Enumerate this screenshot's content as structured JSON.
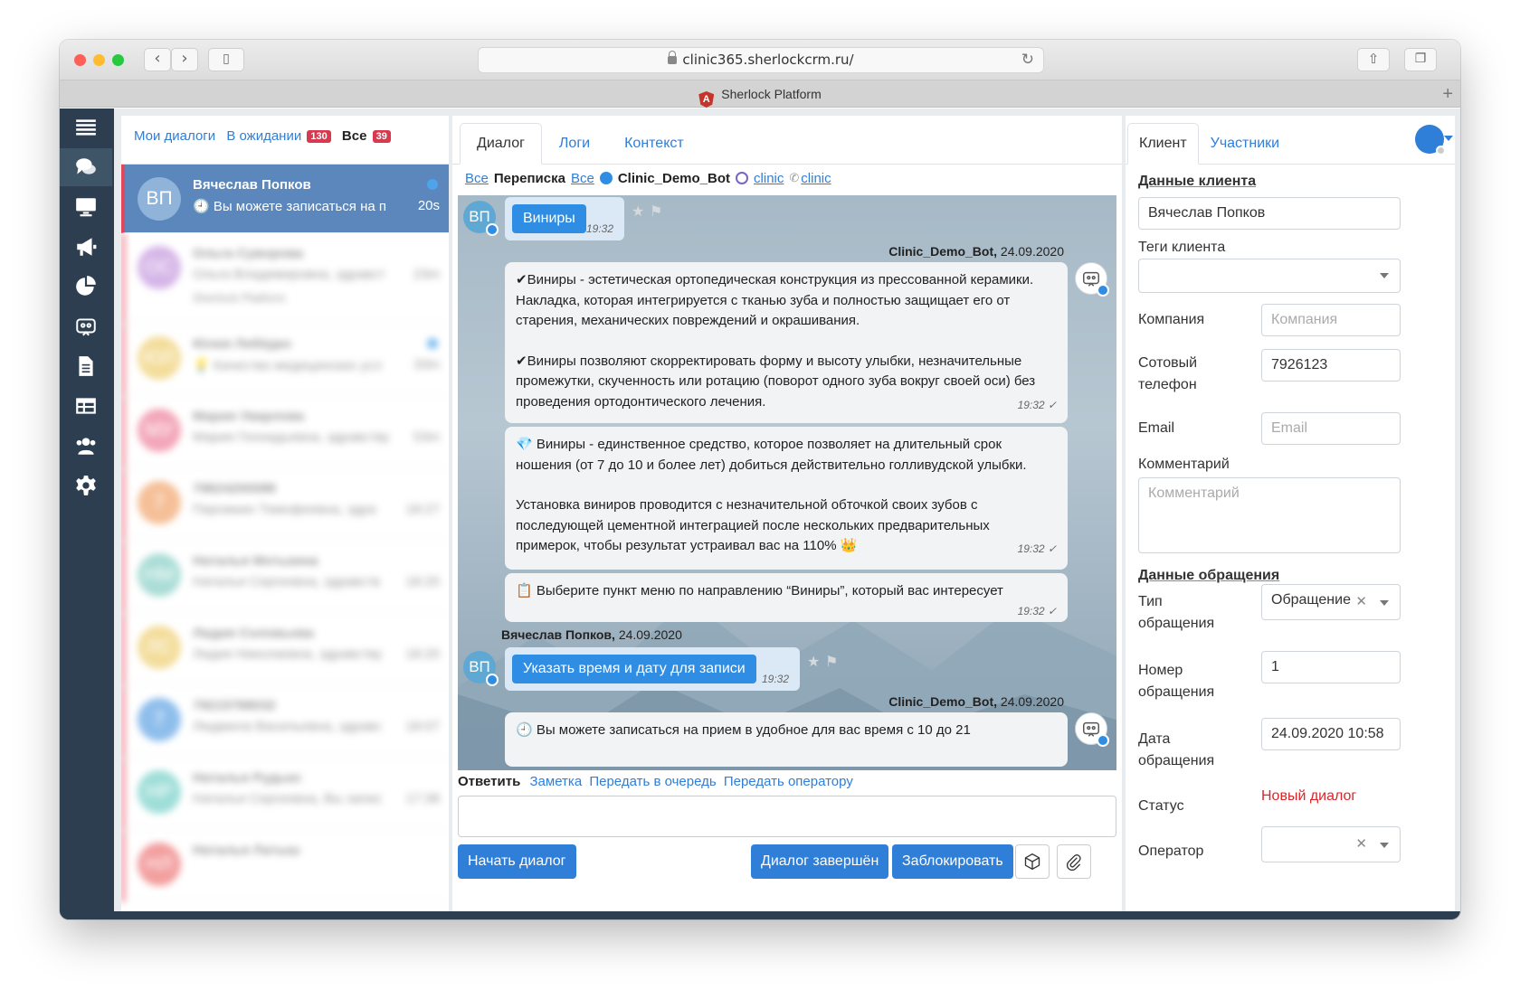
{
  "browser": {
    "url": "clinic365.sherlockcrm.ru/",
    "tab_title": "Sherlock Platform",
    "tab_logo_letter": "A"
  },
  "dialogs": {
    "tabs": [
      {
        "label": "Мои диалоги"
      },
      {
        "label": "В ожидании",
        "badge": "130"
      },
      {
        "label": "Все",
        "badge": "39"
      }
    ],
    "items": [
      {
        "initials": "ВП",
        "name": "Вячеслав Попков",
        "preview": "🕘 Вы можете записаться на п",
        "time": "20s",
        "color": "#8fb3d9"
      },
      {
        "initials": "ОС",
        "name": "Ольга Суворова",
        "preview": "Ольга Владимировна, здравст",
        "time": "23m",
        "extra": "Sherlock Platform",
        "color": "#c89ee0"
      },
      {
        "initials": "ЮЛ",
        "name": "Юлия Лебёдко",
        "preview": "💡 Качество медицинских усл",
        "time": "33m",
        "color": "#f0d27a"
      },
      {
        "initials": "МУ",
        "name": "Мария Уварлова",
        "preview": "Мария Геннадьевна, здравству",
        "time": "53m",
        "color": "#ef8aa2"
      },
      {
        "initials": "7",
        "name": "79824200088",
        "preview": "Пирожкин Тимофеевна, здра",
        "time": "18:27",
        "color": "#f2ab76"
      },
      {
        "initials": "НМ",
        "name": "Наталья Мотькина",
        "preview": "Наталья Сергеевна, здравств",
        "time": "18:20",
        "color": "#8fd2c8"
      },
      {
        "initials": "ЛС",
        "name": "Лидия Соловьева",
        "preview": "Лидия Николаевна, здравству",
        "time": "18:20",
        "color": "#f0d27a"
      },
      {
        "initials": "7",
        "name": "79215788032",
        "preview": "Людмила Васильевна, здравс",
        "time": "18:07",
        "color": "#6aa9e6"
      },
      {
        "initials": "НР",
        "name": "Наталья Рудько",
        "preview": "Наталья Сергеевна, Вы запис",
        "time": "17:38",
        "color": "#7fd3cc"
      },
      {
        "initials": "НЛ",
        "name": "Наталья Латыш",
        "preview": "",
        "time": "",
        "color": "#ef7f7f"
      }
    ]
  },
  "chat": {
    "tabs": [
      "Диалог",
      "Логи",
      "Контекст"
    ],
    "filter": {
      "all1": "Все",
      "label": "Переписка",
      "all2": "Все",
      "bot": "Clinic_Demo_Bot",
      "viber": "clinic",
      "phone": "clinic"
    },
    "messages": {
      "user_initials": "ВП",
      "m1_button": "Виниры",
      "m1_time": "19:32",
      "bot_sender": "Clinic_Demo_Bot,",
      "bot_date": "24.09.2020",
      "b1_p1": "✔Виниры - эстетическая ортопедическая конструкция из прессованной керамики. Накладка, которая интегрируется с тканью зуба и полностью защищает его от старения, механических повреждений и окрашивания.",
      "b1_p2": "✔Виниры позволяют скорректировать форму и высоту улыбки, незначительные промежутки, скученность или ротацию (поворот одного зуба вокруг своей оси) без проведения ортодонтического лечения.",
      "b1_time": "19:32 ✓",
      "b2_p1": "💎 Виниры - единственное средство, которое позволяет на длительный срок ношения (от 7 до 10 и более лет) добиться действительно голливудской улыбки.",
      "b2_p2": "Установка виниров проводится с незначительной обточкой своих зубов с последующей цементной интеграцией после нескольких предварительных примерок, чтобы результат устраивал вас на 110% 👑",
      "b2_time": "19:32 ✓",
      "b3": "📋 Выберите пункт меню по направлению “Виниры”, который вас интересует",
      "b3_time": "19:32 ✓",
      "user_sender": "Вячеслав Попков,",
      "user_date": "24.09.2020",
      "m2_button": "Указать время и дату для записи",
      "m2_time": "19:32",
      "bot_sender2": "Clinic_Demo_Bot,",
      "bot_date2": "24.09.2020",
      "b4": "🕘 Вы можете записаться на прием в удобное для вас время с 10 до 21"
    },
    "reply": {
      "label": "Ответить",
      "links": [
        "Заметка",
        "Передать в очередь",
        "Передать оператору"
      ]
    },
    "buttons": {
      "start": "Начать диалог",
      "finished": "Диалог завершён",
      "block": "Заблокировать"
    }
  },
  "client": {
    "tabs": [
      "Клиент",
      "Участники"
    ],
    "section_client": "Данные клиента",
    "name_value": "Вячеслав Попков",
    "tags_label": "Теги клиента",
    "company_label": "Компания",
    "company_placeholder": "Компания",
    "phone_label": "Сотовый телефон",
    "phone_value": "7926123",
    "email_label": "Email",
    "email_placeholder": "Email",
    "comment_label": "Комментарий",
    "comment_placeholder": "Комментарий",
    "section_request": "Данные обращения",
    "type_label": "Тип обращения",
    "type_value": "Обращение",
    "number_label": "Номер обращения",
    "number_value": "1",
    "date_label": "Дата обращения",
    "date_value": "24.09.2020 10:58",
    "status_label": "Статус",
    "status_value": "Новый диалог",
    "operator_label": "Оператор"
  }
}
